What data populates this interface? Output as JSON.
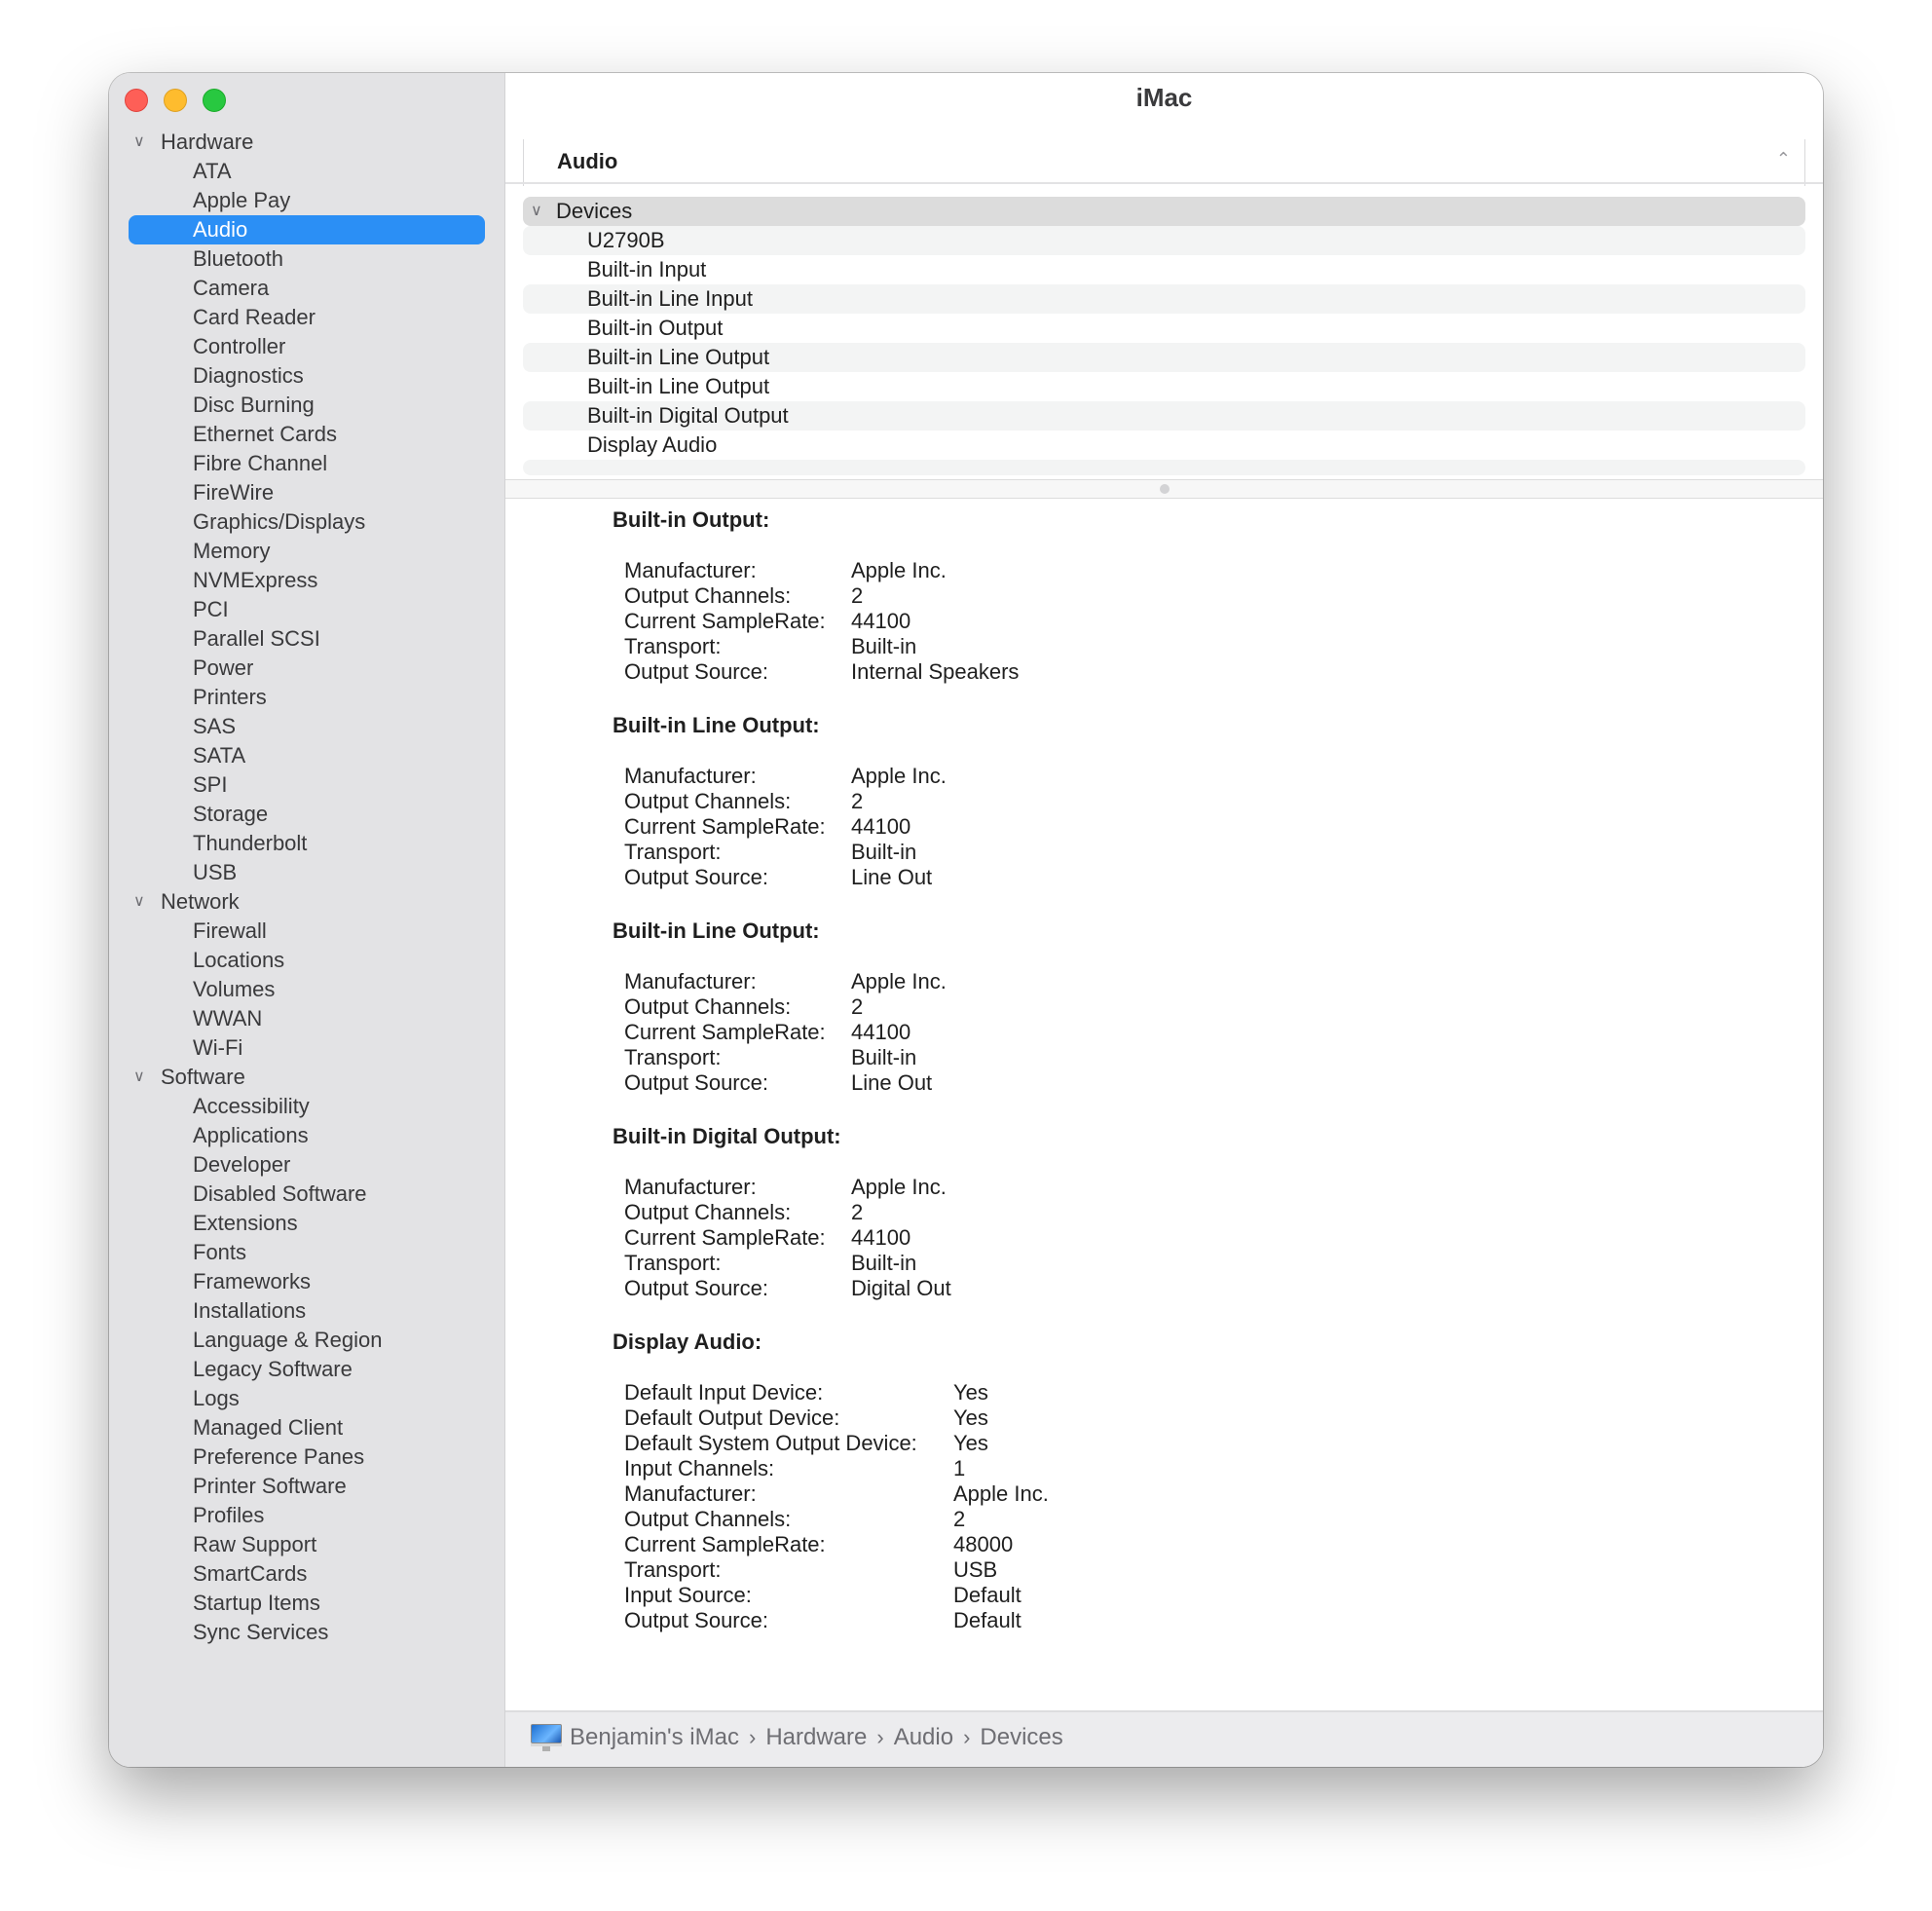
{
  "window": {
    "title": "iMac",
    "traffic_lights": {
      "close": "#fe5f57",
      "minimize": "#febc2e",
      "maximize": "#28c840"
    }
  },
  "accent_color": "#2b8ff5",
  "sidebar": {
    "groups": [
      {
        "label": "Hardware",
        "expanded": true,
        "items": [
          "ATA",
          "Apple Pay",
          "Audio",
          "Bluetooth",
          "Camera",
          "Card Reader",
          "Controller",
          "Diagnostics",
          "Disc Burning",
          "Ethernet Cards",
          "Fibre Channel",
          "FireWire",
          "Graphics/Displays",
          "Memory",
          "NVMExpress",
          "PCI",
          "Parallel SCSI",
          "Power",
          "Printers",
          "SAS",
          "SATA",
          "SPI",
          "Storage",
          "Thunderbolt",
          "USB"
        ]
      },
      {
        "label": "Network",
        "expanded": true,
        "items": [
          "Firewall",
          "Locations",
          "Volumes",
          "WWAN",
          "Wi-Fi"
        ]
      },
      {
        "label": "Software",
        "expanded": true,
        "items": [
          "Accessibility",
          "Applications",
          "Developer",
          "Disabled Software",
          "Extensions",
          "Fonts",
          "Frameworks",
          "Installations",
          "Language & Region",
          "Legacy Software",
          "Logs",
          "Managed Client",
          "Preference Panes",
          "Printer Software",
          "Profiles",
          "Raw Support",
          "SmartCards",
          "Startup Items",
          "Sync Services"
        ]
      }
    ],
    "selected": "Audio"
  },
  "main": {
    "column_header": "Audio",
    "list": {
      "group_label": "Devices",
      "items": [
        "U2790B",
        "Built-in Input",
        "Built-in Line Input",
        "Built-in Output",
        "Built-in Line Output",
        "Built-in Line Output",
        "Built-in Digital Output",
        "Display Audio"
      ]
    },
    "details": [
      {
        "title": "Built-in Output:",
        "fields": [
          {
            "key": "Manufacturer:",
            "value": "Apple Inc."
          },
          {
            "key": "Output Channels:",
            "value": "2"
          },
          {
            "key": "Current SampleRate:",
            "value": "44100"
          },
          {
            "key": "Transport:",
            "value": "Built-in"
          },
          {
            "key": "Output Source:",
            "value": "Internal Speakers"
          }
        ]
      },
      {
        "title": "Built-in Line Output:",
        "fields": [
          {
            "key": "Manufacturer:",
            "value": "Apple Inc."
          },
          {
            "key": "Output Channels:",
            "value": "2"
          },
          {
            "key": "Current SampleRate:",
            "value": "44100"
          },
          {
            "key": "Transport:",
            "value": "Built-in"
          },
          {
            "key": "Output Source:",
            "value": "Line Out"
          }
        ]
      },
      {
        "title": "Built-in Line Output:",
        "fields": [
          {
            "key": "Manufacturer:",
            "value": "Apple Inc."
          },
          {
            "key": "Output Channels:",
            "value": "2"
          },
          {
            "key": "Current SampleRate:",
            "value": "44100"
          },
          {
            "key": "Transport:",
            "value": "Built-in"
          },
          {
            "key": "Output Source:",
            "value": "Line Out"
          }
        ]
      },
      {
        "title": "Built-in Digital Output:",
        "fields": [
          {
            "key": "Manufacturer:",
            "value": "Apple Inc."
          },
          {
            "key": "Output Channels:",
            "value": "2"
          },
          {
            "key": "Current SampleRate:",
            "value": "44100"
          },
          {
            "key": "Transport:",
            "value": "Built-in"
          },
          {
            "key": "Output Source:",
            "value": "Digital Out"
          }
        ]
      },
      {
        "title": "Display Audio:",
        "fields": [
          {
            "key": "Default Input Device:",
            "value": "Yes"
          },
          {
            "key": "Default Output Device:",
            "value": "Yes"
          },
          {
            "key": "Default System Output Device:",
            "value": "Yes"
          },
          {
            "key": "Input Channels:",
            "value": "1"
          },
          {
            "key": "Manufacturer:",
            "value": "Apple Inc."
          },
          {
            "key": "Output Channels:",
            "value": "2"
          },
          {
            "key": "Current SampleRate:",
            "value": "48000"
          },
          {
            "key": "Transport:",
            "value": "USB"
          },
          {
            "key": "Input Source:",
            "value": "Default"
          },
          {
            "key": "Output Source:",
            "value": "Default"
          }
        ]
      }
    ]
  },
  "breadcrumb": {
    "icon": "imac-icon",
    "separator": "›",
    "items": [
      "Benjamin's iMac",
      "Hardware",
      "Audio",
      "Devices"
    ]
  },
  "icons": {
    "expand": "chevron-down-icon",
    "collapse_column": "chevron-up-icon"
  }
}
